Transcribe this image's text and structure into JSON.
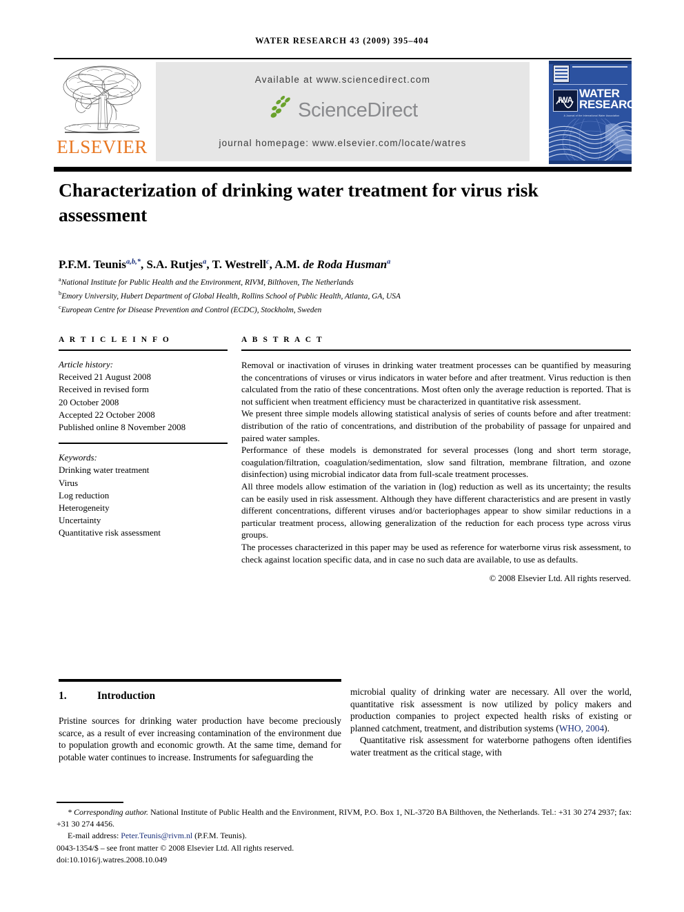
{
  "running_head": "WATER RESEARCH 43 (2009) 395–404",
  "header": {
    "available_at": "Available at www.sciencedirect.com",
    "sciencedirect_label": "ScienceDirect",
    "journal_homepage": "journal homepage: www.elsevier.com/locate/watres",
    "elsevier_label": "ELSEVIER",
    "cover": {
      "iwa_label": "IWA",
      "title_line1": "WATER",
      "title_line2": "RESEARCH",
      "subtitle": "A Journal of the International Water Association"
    }
  },
  "article": {
    "title": "Characterization of drinking water treatment for virus risk assessment",
    "authors_html": "P.F.M. Teunis<sup>a,b,*</sup>, S.A. Rutjes<sup>a</sup>, T. Westrell<sup>c</sup>, A.M. <span class=\"it\">de Roda Husman</span><sup>a</sup>",
    "affiliations": [
      "National Institute for Public Health and the Environment, RIVM, Bilthoven, The Netherlands",
      "Emory University, Hubert Department of Global Health, Rollins School of Public Health, Atlanta, GA, USA",
      "European Centre for Disease Prevention and Control (ECDC), Stockholm, Sweden"
    ],
    "affiliation_marks": [
      "a",
      "b",
      "c"
    ]
  },
  "info": {
    "heading": "A R T I C L E  I N F O",
    "history_label": "Article history:",
    "history": [
      "Received 21 August 2008",
      "Received in revised form",
      "20 October 2008",
      "Accepted 22 October 2008",
      "Published online 8 November 2008"
    ],
    "keywords_label": "Keywords:",
    "keywords": [
      "Drinking water treatment",
      "Virus",
      "Log reduction",
      "Heterogeneity",
      "Uncertainty",
      "Quantitative risk assessment"
    ]
  },
  "abstract": {
    "heading": "A B S T R A C T",
    "paragraphs": [
      "Removal or inactivation of viruses in drinking water treatment processes can be quantified by measuring the concentrations of viruses or virus indicators in water before and after treatment. Virus reduction is then calculated from the ratio of these concentrations. Most often only the average reduction is reported. That is not sufficient when treatment efficiency must be characterized in quantitative risk assessment.",
      "We present three simple models allowing statistical analysis of series of counts before and after treatment: distribution of the ratio of concentrations, and distribution of the probability of passage for unpaired and paired water samples.",
      "Performance of these models is demonstrated for several processes (long and short term storage, coagulation/filtration, coagulation/sedimentation, slow sand filtration, membrane filtration, and ozone disinfection) using microbial indicator data from full-scale treatment processes.",
      "All three models allow estimation of the variation in (log) reduction as well as its uncertainty; the results can be easily used in risk assessment. Although they have different characteristics and are present in vastly different concentrations, different viruses and/or bacteriophages appear to show similar reductions in a particular treatment process, allowing generalization of the reduction for each process type across virus groups.",
      "The processes characterized in this paper may be used as reference for waterborne virus risk assessment, to check against location specific data, and in case no such data are available, to use as defaults."
    ],
    "copyright": "© 2008 Elsevier Ltd. All rights reserved."
  },
  "body": {
    "section_number": "1.",
    "section_title": "Introduction",
    "left_paragraph": "Pristine sources for drinking water production have become preciously scarce, as a result of ever increasing contamination of the environment due to population growth and economic growth. At the same time, demand for potable water continues to increase. Instruments for safeguarding the",
    "right_paragraph_1a": "microbial quality of drinking water are necessary. All over the world, quantitative risk assessment is now utilized by policy makers and production companies to project expected health risks of existing or planned catchment, treatment, and distribution systems (",
    "right_citation": "WHO, 2004",
    "right_paragraph_1b": ").",
    "right_paragraph_2": "Quantitative risk assessment for waterborne pathogens often identifies water treatment as the critical stage, with"
  },
  "footnote": {
    "corresponding_label": "* Corresponding author.",
    "corresponding_text": " National Institute of Public Health and the Environment, RIVM, P.O. Box 1, NL-3720 BA Bilthoven, the Netherlands. Tel.: +31 30 274 2937; fax: +31 30 274 4456.",
    "email_label": "E-mail address:",
    "email": "Peter.Teunis@rivm.nl",
    "email_suffix": " (P.F.M. Teunis).",
    "issn_line": "0043-1354/$ – see front matter © 2008 Elsevier Ltd. All rights reserved.",
    "doi_line": "doi:10.1016/j.watres.2008.10.049"
  },
  "colors": {
    "elsevier_orange": "#E87722",
    "sciencedirect_green": "#6aa22c",
    "sciencedirect_gray": "#898a8d",
    "cover_blue": "#2c52a0",
    "link_blue": "#1a2f7a"
  }
}
